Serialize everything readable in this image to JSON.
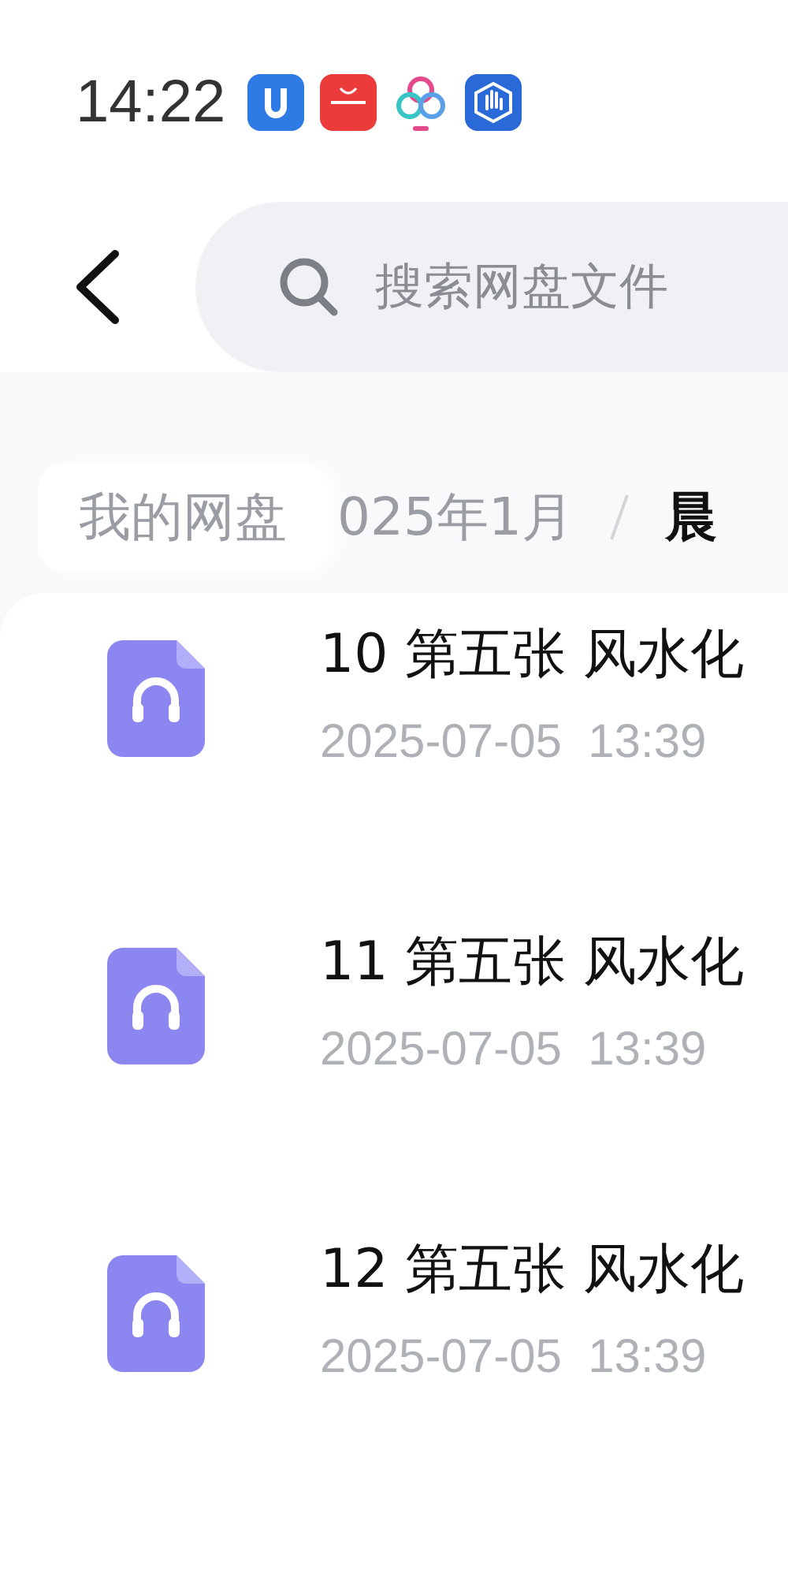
{
  "status_bar": {
    "time": "14:22"
  },
  "search": {
    "placeholder": "搜索网盘文件"
  },
  "breadcrumb": [
    {
      "label": "我的网盘",
      "kind": "root"
    },
    {
      "label": "025年1月",
      "kind": "folder"
    },
    {
      "label": "晨",
      "kind": "current"
    }
  ],
  "files": [
    {
      "name": "10 第五张 风水化",
      "modified": "2025-07-05  13:39"
    },
    {
      "name": "11 第五张 风水化",
      "modified": "2025-07-05  13:39"
    },
    {
      "name": "12 第五张 风水化",
      "modified": "2025-07-05  13:39"
    }
  ]
}
